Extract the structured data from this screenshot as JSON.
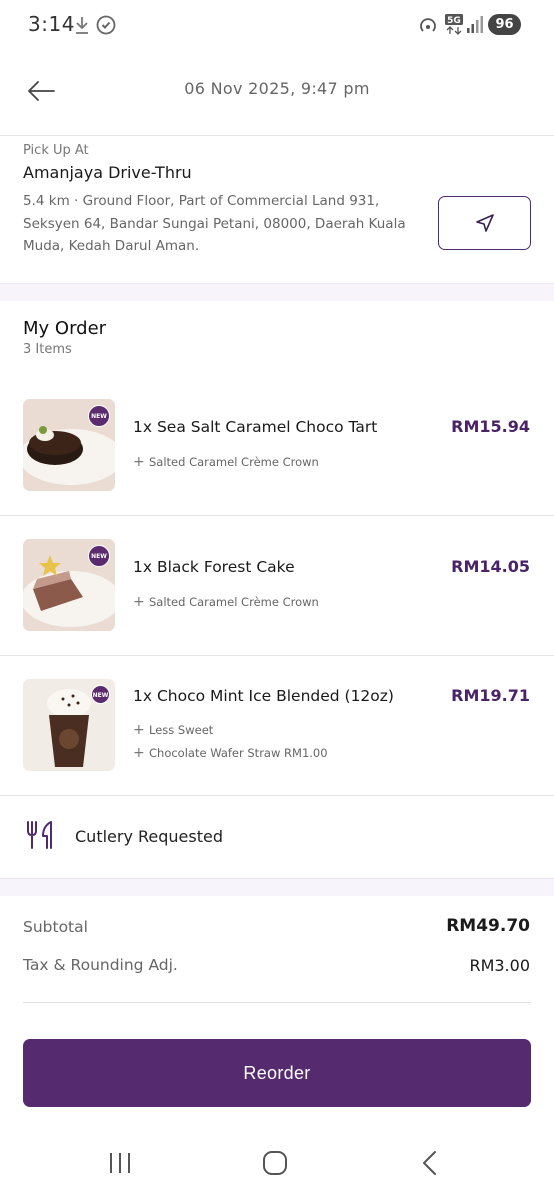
{
  "status_bar": {
    "time": "3:14",
    "battery": "96"
  },
  "header": {
    "datetime": "06 Nov 2025, 9:47 pm"
  },
  "pickup": {
    "label": "Pick Up At",
    "store": "Amanjaya Drive-Thru",
    "address": "5.4 km  ·  Ground Floor, Part of Commercial Land 931, Seksyen 64, Bandar Sungai Petani, 08000, Daerah Kuala Muda, Kedah Darul Aman."
  },
  "order": {
    "title": "My Order",
    "count": "3 Items",
    "items": [
      {
        "name": "1x Sea Salt Caramel Choco Tart",
        "price": "RM15.94",
        "badge": "NEW",
        "addons": [
          "Salted Caramel Crème Crown"
        ]
      },
      {
        "name": "1x Black Forest Cake",
        "price": "RM14.05",
        "badge": "NEW",
        "addons": [
          "Salted Caramel Crème Crown"
        ]
      },
      {
        "name": "1x Choco Mint Ice Blended (12oz)",
        "price": "RM19.71",
        "badge": "NEW",
        "addons": [
          "Less Sweet",
          "Chocolate Wafer Straw RM1.00"
        ]
      }
    ]
  },
  "cutlery": {
    "label": "Cutlery Requested"
  },
  "summary": {
    "subtotal_label": "Subtotal",
    "subtotal_value": "RM49.70",
    "tax_label": "Tax & Rounding Adj.",
    "tax_value": "RM3.00"
  },
  "actions": {
    "reorder_label": "Reorder"
  },
  "colors": {
    "brand": "#552a6e",
    "price": "#4a2266",
    "band": "#f7f5fb"
  },
  "icons": [
    "download-icon",
    "shield-icon",
    "hotspot-icon",
    "5g-icon",
    "signal-icon",
    "battery-icon",
    "back-arrow-icon",
    "navigate-icon",
    "plus-icon",
    "cutlery-icon",
    "recent-apps-icon",
    "home-icon",
    "back-icon"
  ]
}
